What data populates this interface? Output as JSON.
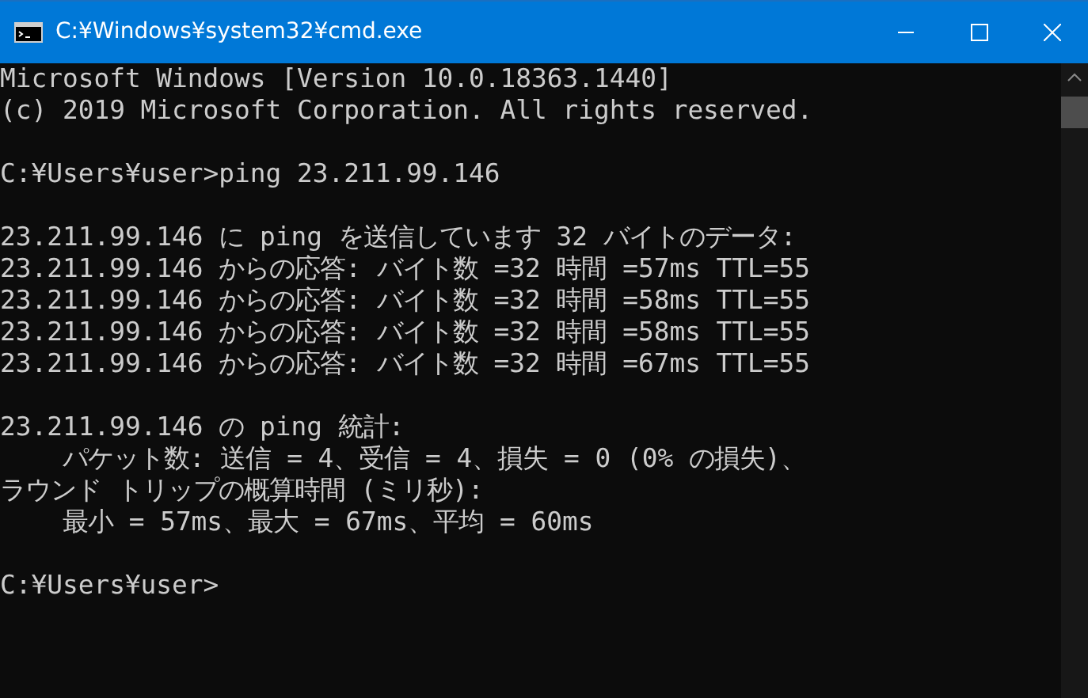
{
  "window": {
    "title": "C:¥Windows¥system32¥cmd.exe"
  },
  "console": {
    "blocks": [
      {
        "lines": [
          "Microsoft Windows [Version 10.0.18363.1440]",
          "(c) 2019 Microsoft Corporation. All rights reserved."
        ]
      },
      {
        "lines": [
          "C:¥Users¥user>ping 23.211.99.146"
        ]
      },
      {
        "lines": [
          "23.211.99.146 に ping を送信しています 32 バイトのデータ:",
          "23.211.99.146 からの応答: バイト数 =32 時間 =57ms TTL=55",
          "23.211.99.146 からの応答: バイト数 =32 時間 =58ms TTL=55",
          "23.211.99.146 からの応答: バイト数 =32 時間 =58ms TTL=55",
          "23.211.99.146 からの応答: バイト数 =32 時間 =67ms TTL=55"
        ]
      },
      {
        "lines": [
          "23.211.99.146 の ping 統計:",
          "    パケット数: 送信 = 4、受信 = 4、損失 = 0 (0% の損失)、",
          "ラウンド トリップの概算時間 (ミリ秒):",
          "    最小 = 57ms、最大 = 67ms、平均 = 60ms"
        ]
      },
      {
        "lines": [
          "C:¥Users¥user>"
        ]
      }
    ]
  }
}
